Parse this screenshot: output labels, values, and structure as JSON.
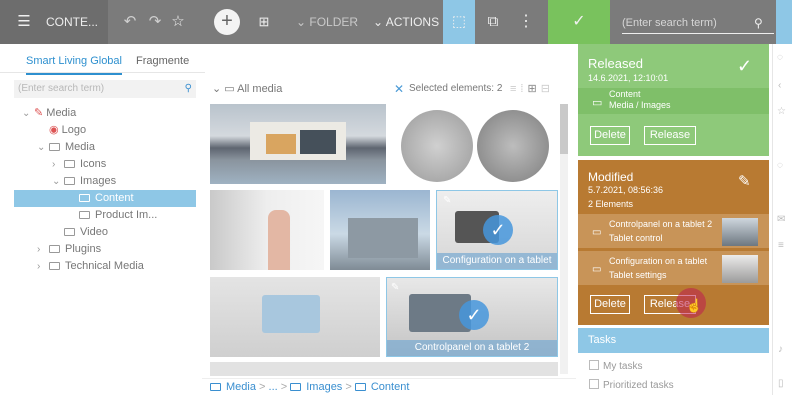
{
  "topbar": {
    "menu_icon": "hamburger-icon",
    "title": "CONTE...",
    "folder_label": "FOLDER",
    "actions_label": "ACTIONS",
    "search_placeholder": "(Enter search term)"
  },
  "left": {
    "tabs": [
      "Smart Living Global",
      "Fragmente"
    ],
    "search_placeholder": "(Enter search term)",
    "tree": [
      {
        "label": "Media",
        "indent": 0,
        "icon": "pencil-icon",
        "chev": "v"
      },
      {
        "label": "Logo",
        "indent": 1,
        "icon": "eye-icon",
        "chev": ""
      },
      {
        "label": "Media",
        "indent": 1,
        "icon": "folder-icon",
        "chev": "v"
      },
      {
        "label": "Icons",
        "indent": 2,
        "icon": "folder-icon",
        "chev": ">"
      },
      {
        "label": "Images",
        "indent": 2,
        "icon": "folder-icon",
        "chev": "v"
      },
      {
        "label": "Content",
        "indent": 3,
        "icon": "folder-icon",
        "chev": "",
        "selected": true
      },
      {
        "label": "Product Im...",
        "indent": 3,
        "icon": "folder-icon",
        "chev": ""
      },
      {
        "label": "Video",
        "indent": 2,
        "icon": "folder-icon",
        "chev": ""
      },
      {
        "label": "Plugins",
        "indent": 1,
        "icon": "folder-icon",
        "chev": ">"
      },
      {
        "label": "Technical Media",
        "indent": 1,
        "icon": "folder-icon",
        "chev": ">"
      }
    ]
  },
  "middle": {
    "all_media": "All media",
    "selected_text": "Selected elements: 2",
    "caption1": "Configuration on a tablet",
    "caption2": "Controlpanel on a tablet 2",
    "breadcrumb": [
      "Media",
      "...",
      "Images",
      "Content"
    ]
  },
  "right": {
    "released_title": "Released",
    "released_date": "14.6.2021, 12:10:01",
    "released_item_line1": "Content",
    "released_item_line2": "Media / Images",
    "delete_label": "Delete",
    "release_label": "Release",
    "modified_title": "Modified",
    "modified_date": "5.7.2021, 08:56:36",
    "modified_count": "2 Elements",
    "item1_line1": "Controlpanel on a tablet 2",
    "item1_line2": "Tablet control",
    "item2_line1": "Configuration on a tablet",
    "item2_line2": "Tablet settings",
    "delete2_label": "Delete",
    "release2_label": "Release",
    "tasks_title": "Tasks",
    "task1": "My tasks",
    "task2": "Prioritized tasks"
  },
  "colors": {
    "accent": "#2e90cf",
    "green": "#8ec97a",
    "brown": "#b87a32",
    "topbar": "#7b7b7b"
  }
}
